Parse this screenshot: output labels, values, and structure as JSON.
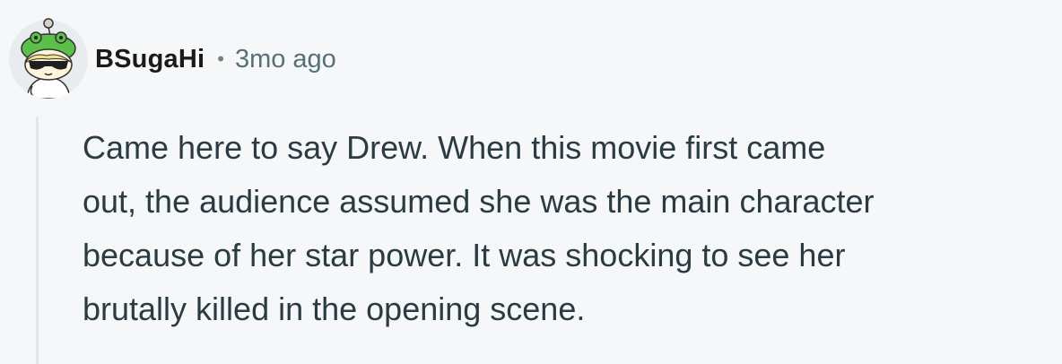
{
  "comment": {
    "author": "BSugaHi",
    "separator": "•",
    "timestamp": "3mo ago",
    "avatar_icon": "snoo-avatar-icon",
    "body_lines": [
      "Came here to say Drew. When this movie first came",
      "out, the audience assumed she was the main character",
      "because of her star power. It was shocking to see her",
      "brutally killed in the opening scene."
    ]
  },
  "colors": {
    "background": "#f6f7f8",
    "thread_line": "#e4e6e8",
    "author_text": "#1a1a1b",
    "meta_text": "#576f76",
    "body_text": "#2a3c42"
  }
}
